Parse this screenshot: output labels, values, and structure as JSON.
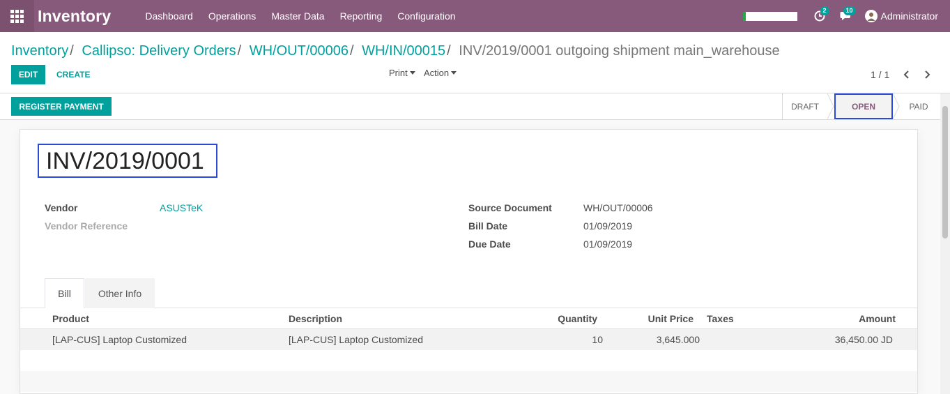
{
  "app": {
    "name": "Inventory"
  },
  "nav": {
    "menu": [
      "Dashboard",
      "Operations",
      "Master Data",
      "Reporting",
      "Configuration"
    ],
    "activity_count": "2",
    "messages_count": "10",
    "user": "Administrator"
  },
  "breadcrumb": {
    "items": [
      "Inventory",
      "Callipso: Delivery Orders",
      "WH/OUT/00006",
      "WH/IN/00015"
    ],
    "current": "INV/2019/0001 outgoing shipment main_warehouse"
  },
  "buttons": {
    "edit": "EDIT",
    "create": "CREATE",
    "print": "Print",
    "action": "Action",
    "register_payment": "REGISTER PAYMENT"
  },
  "pager": {
    "value": "1 / 1"
  },
  "stages": [
    "DRAFT",
    "OPEN",
    "PAID"
  ],
  "stage_current": "OPEN",
  "record": {
    "title": "INV/2019/0001",
    "vendor_label": "Vendor",
    "vendor": "ASUSTeK",
    "vendor_ref_label": "Vendor Reference",
    "source_label": "Source Document",
    "source": "WH/OUT/00006",
    "bill_date_label": "Bill Date",
    "bill_date": "01/09/2019",
    "due_date_label": "Due Date",
    "due_date": "01/09/2019"
  },
  "tabs": [
    "Bill",
    "Other Info"
  ],
  "table": {
    "columns": [
      "Product",
      "Description",
      "Quantity",
      "Unit Price",
      "Taxes",
      "Amount"
    ],
    "rows": [
      {
        "product": "[LAP-CUS] Laptop Customized",
        "description": "[LAP-CUS] Laptop Customized",
        "quantity": "10",
        "unit_price": "3,645.000",
        "taxes": "",
        "amount": "36,450.00 JD"
      }
    ]
  },
  "colors": {
    "navbar": "#875a7b",
    "accent": "#00a09d",
    "highlight_box": "#2b4bd3"
  }
}
